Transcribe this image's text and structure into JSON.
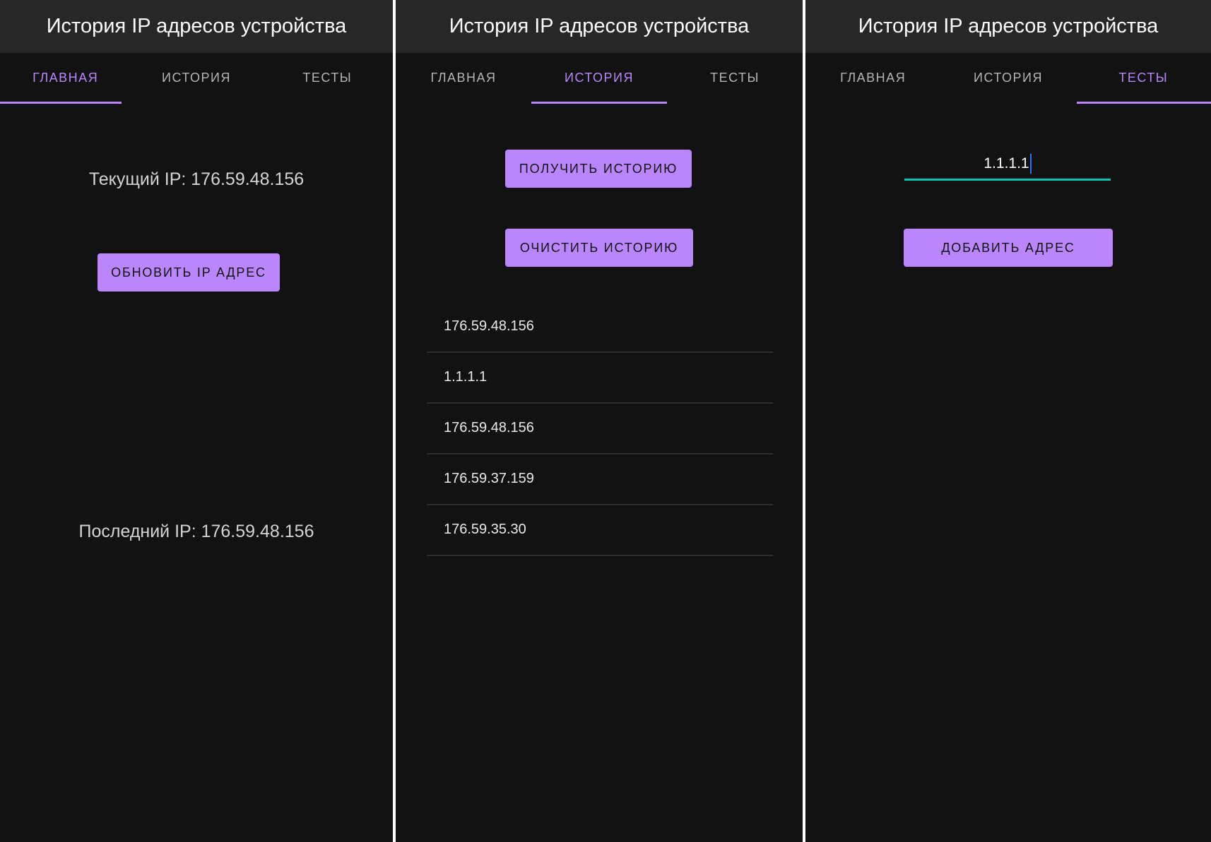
{
  "app_title": "История IP адресов устройства",
  "tabs": {
    "main": "ГЛАВНАЯ",
    "history": "ИСТОРИЯ",
    "tests": "ТЕСТЫ"
  },
  "main_screen": {
    "current_ip": "Текущий IP: 176.59.48.156",
    "refresh_button": "ОБНОВИТЬ IP АДРЕС",
    "last_ip": "Последний IP: 176.59.48.156"
  },
  "history_screen": {
    "get_button": "ПОЛУЧИТЬ ИСТОРИЮ",
    "clear_button": "ОЧИСТИТЬ ИСТОРИЮ",
    "items": [
      "176.59.48.156",
      "1.1.1.1",
      "176.59.48.156",
      "176.59.37.159",
      "176.59.35.30"
    ]
  },
  "tests_screen": {
    "input_value": "1.1.1.1",
    "add_button": "ДОБАВИТЬ АДРЕС"
  },
  "colors": {
    "accent": "#bb86fc",
    "background": "#121212",
    "appbar": "#272727",
    "field_underline": "#03c2b0",
    "caret": "#2f74ff"
  }
}
